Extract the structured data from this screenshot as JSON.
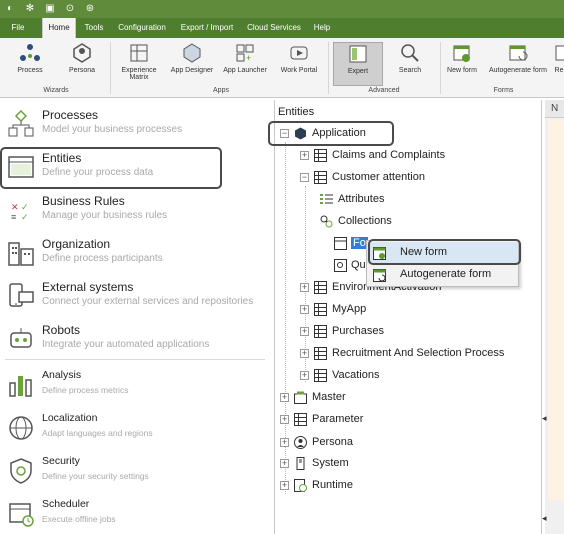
{
  "menu": {
    "tabs": [
      "File",
      "Home",
      "Tools",
      "Configuration",
      "Export / Import",
      "Cloud Services",
      "Help"
    ],
    "active": "Home"
  },
  "ribbon": {
    "buttons": {
      "process": "Process",
      "persona": "Persona",
      "experience_matrix": "Experience Matrix",
      "app_designer": "App Designer",
      "app_launcher": "App Launcher",
      "work_portal": "Work Portal",
      "expert": "Expert",
      "search": "Search",
      "new_form": "New form",
      "autogenerate_form": "Autogenerate form",
      "re": "Re"
    },
    "groups": {
      "wizards": "Wizards",
      "apps": "Apps",
      "advanced": "Advanced",
      "forms": "Forms"
    }
  },
  "left_panel": {
    "items": [
      {
        "title": "Processes",
        "subtitle": "Model your business processes"
      },
      {
        "title": "Entities",
        "subtitle": "Define your process data"
      },
      {
        "title": "Business Rules",
        "subtitle": "Manage your business rules"
      },
      {
        "title": "Organization",
        "subtitle": "Define process participants"
      },
      {
        "title": "External systems",
        "subtitle": "Connect your external services and repositories"
      },
      {
        "title": "Robots",
        "subtitle": "Integrate your automated applications"
      },
      {
        "title": "Analysis",
        "subtitle": "Define process metrics"
      },
      {
        "title": "Localization",
        "subtitle": "Adapt languages and regions"
      },
      {
        "title": "Security",
        "subtitle": "Define your security settings"
      },
      {
        "title": "Scheduler",
        "subtitle": "Execute offline jobs"
      }
    ]
  },
  "tree": {
    "title": "Entities",
    "root": "Application",
    "nodes": {
      "claims": "Claims and Complaints",
      "customer_attention": "Customer attention",
      "attributes": "Attributes",
      "collections": "Collections",
      "forms": "Fo",
      "queries": "Qu",
      "environment": "EnvironmentActivation",
      "myapp": "MyApp",
      "purchases": "Purchases",
      "recruitment": "Recruitment And Selection Process",
      "vacations": "Vacations",
      "master": "Master",
      "parameter": "Parameter",
      "persona": "Persona",
      "system": "System",
      "runtime": "Runtime"
    }
  },
  "context_menu": {
    "new_form": "New form",
    "autogenerate_form": "Autogenerate form"
  },
  "far_right": {
    "header": "N"
  },
  "colors": {
    "title_bar": "#5f8b3b",
    "menu_bar": "#4f7f2e",
    "accent_green": "#5c9a2b"
  }
}
